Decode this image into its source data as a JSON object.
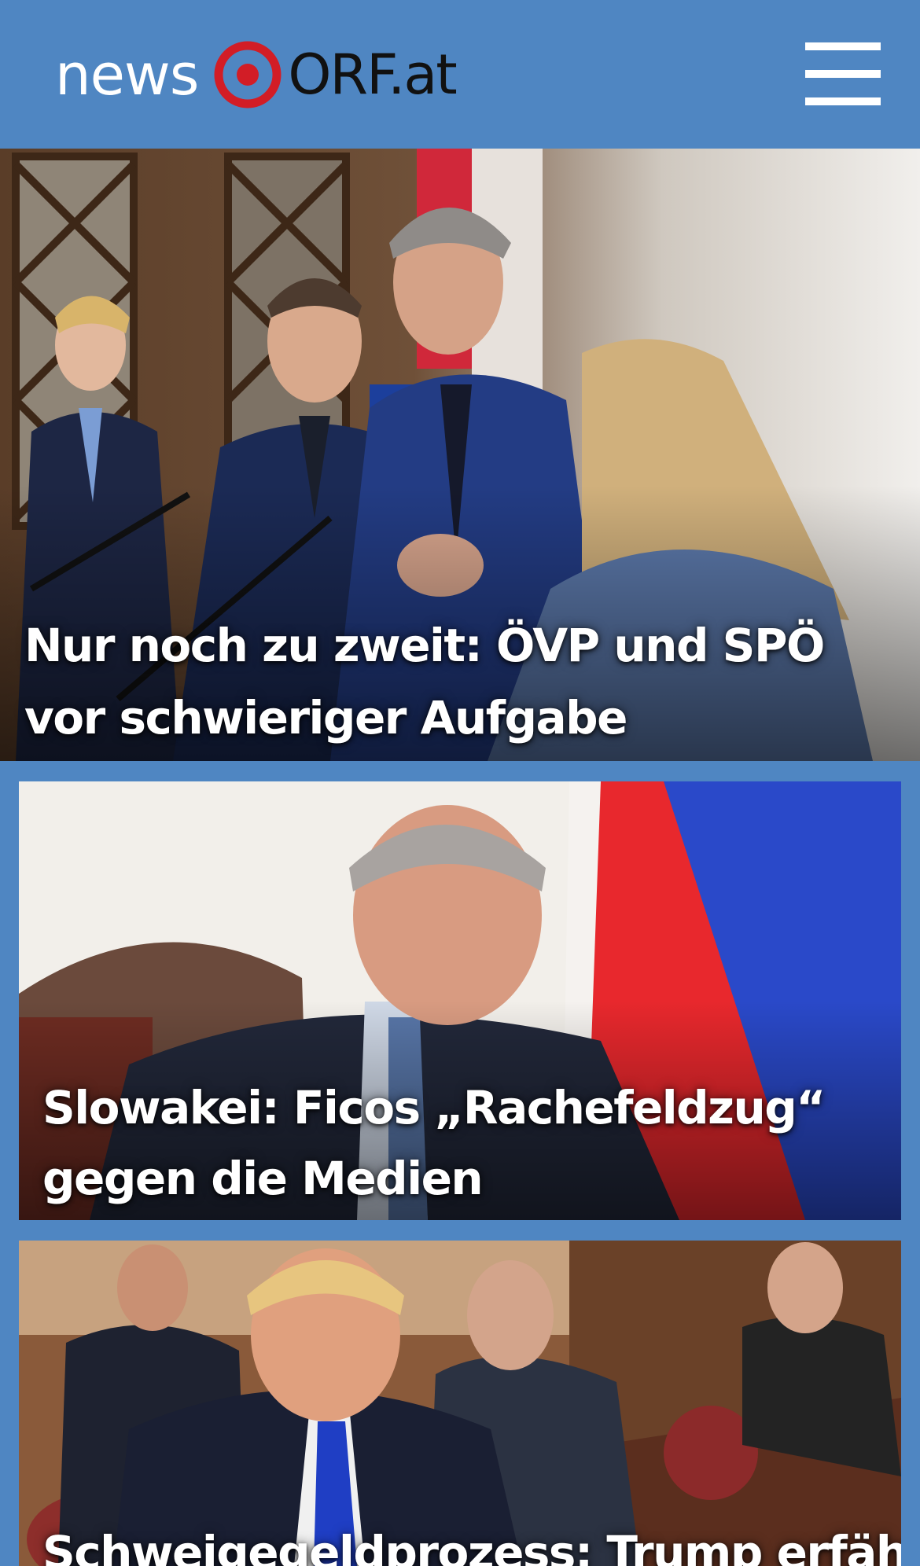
{
  "header": {
    "logo_news": "news",
    "logo_orf": "ORF.at",
    "menu_icon": "hamburger-menu-icon"
  },
  "colors": {
    "header_bg": "#4f86c2",
    "logo_red": "#d21d26",
    "title_text": "#ffffff"
  },
  "stories": [
    {
      "title": "Nur noch zu zweit: ÖVP und SPÖ vor schwieriger Aufgabe"
    },
    {
      "title": "Slowakei: Ficos „Rachefeldzug“ gegen die Medien"
    },
    {
      "title": "Schweigegeldprozess: Trump erfährt"
    }
  ]
}
